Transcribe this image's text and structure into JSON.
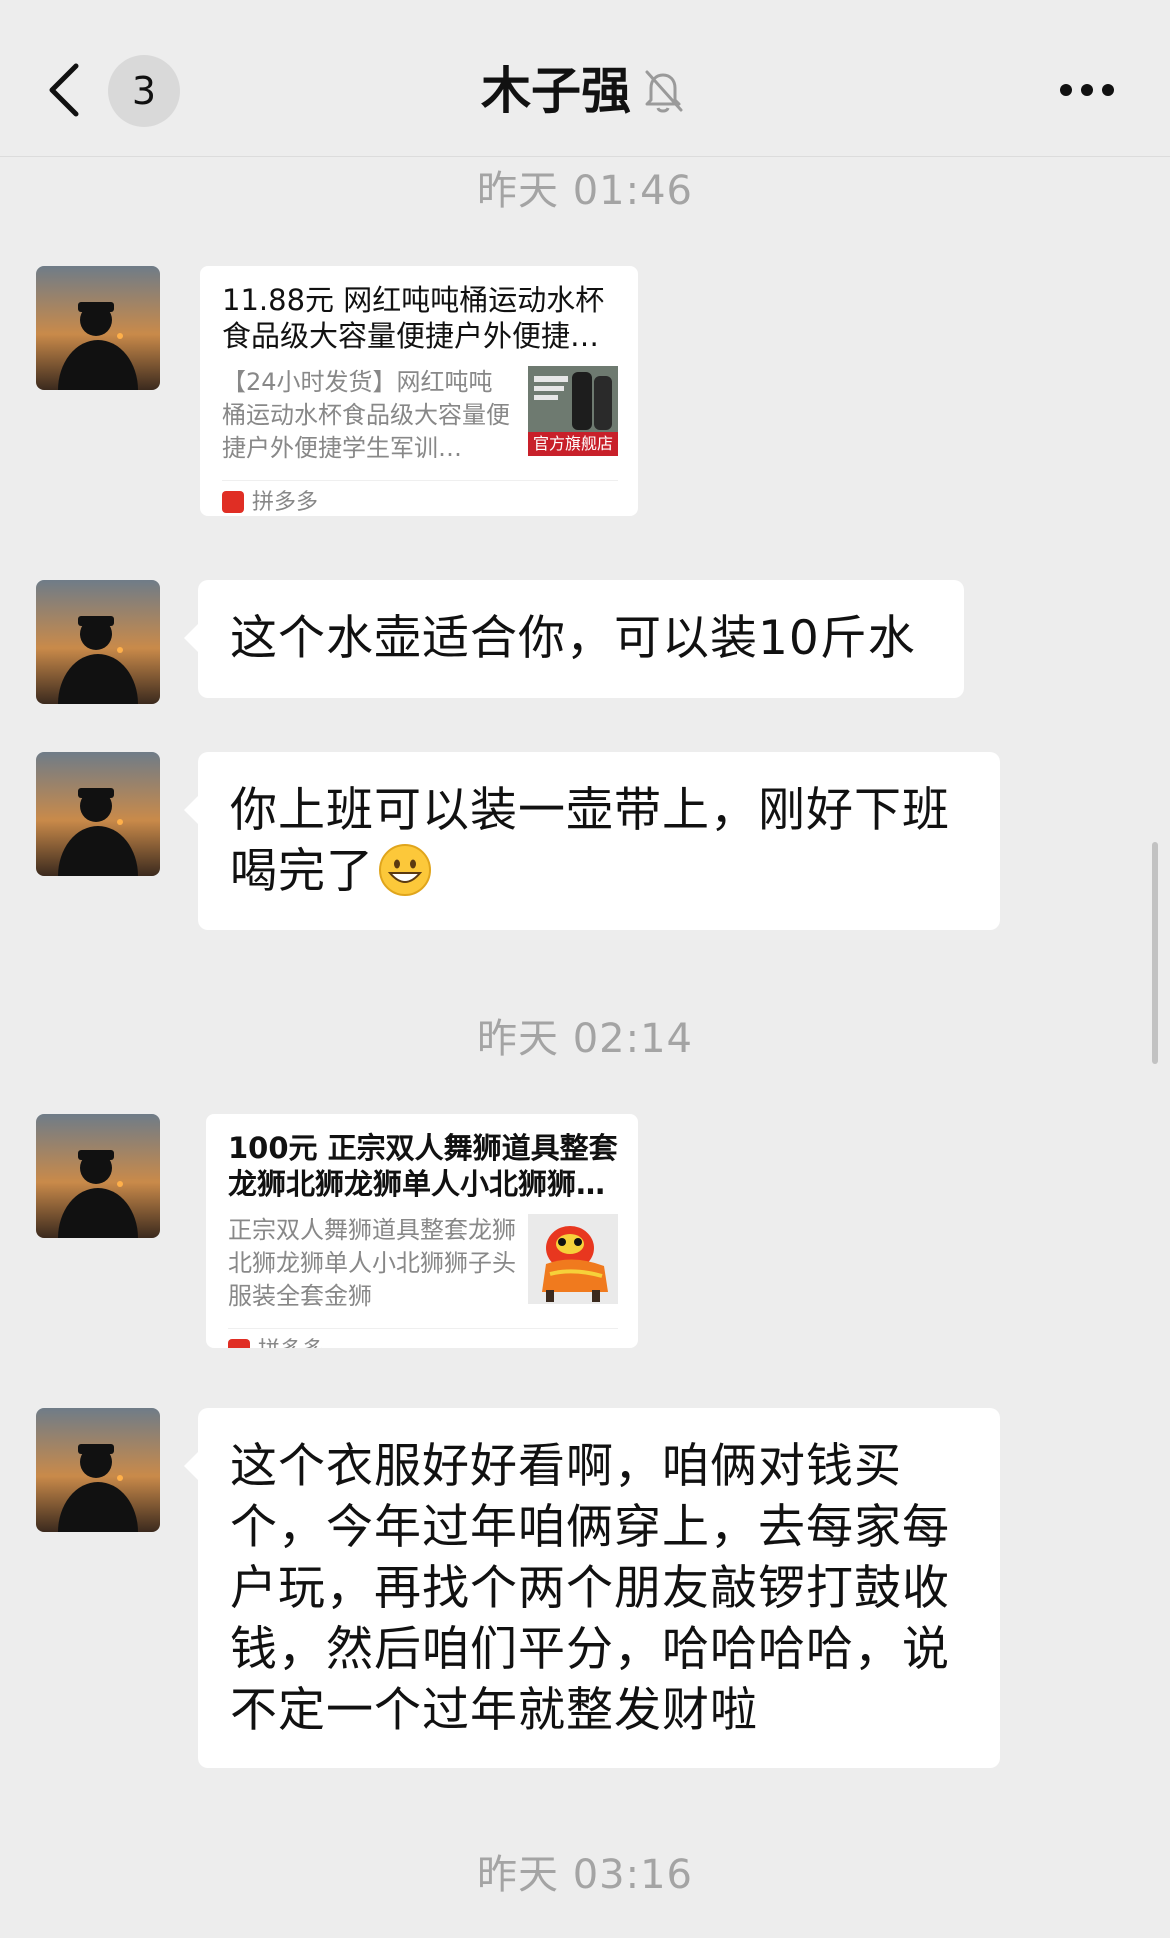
{
  "header": {
    "back_icon": "chevron-left-icon",
    "unread_count": "3",
    "title": "木子强",
    "mute_icon": "bell-muted-icon",
    "more_icon": "more-dots-icon"
  },
  "messages": [
    {
      "type": "time",
      "text": "昨天 01:46"
    },
    {
      "type": "card",
      "title": "11.88元 网红吨吨桶运动水杯食品级大容量便捷户外便捷…",
      "desc": "【24小时发货】网红吨吨桶运动水杯食品级大容量便捷户外便捷学生军训…",
      "thumb_badge": "官方旗舰店",
      "source": "拼多多"
    },
    {
      "type": "text",
      "text": "这个水壶适合你，可以装10斤水"
    },
    {
      "type": "text",
      "text": "你上班可以装一壶带上，刚好下班喝完了",
      "emoji": "grinning-face-emoji"
    },
    {
      "type": "time",
      "text": "昨天 02:14"
    },
    {
      "type": "card",
      "title": "100元 正宗双人舞狮道具整套龙狮北狮龙狮单人小北狮狮…",
      "desc": "正宗双人舞狮道具整套龙狮北狮龙狮单人小北狮狮子头服装全套金狮",
      "source": "拼多多"
    },
    {
      "type": "text",
      "text": "这个衣服好好看啊，咱俩对钱买个，今年过年咱俩穿上，去每家每户玩，再找个两个朋友敲锣打鼓收钱，然后咱们平分，哈哈哈哈，说不定一个过年就整发财啦"
    },
    {
      "type": "time",
      "text": "昨天 03:16"
    }
  ],
  "colors": {
    "background": "#ededed",
    "bubble": "#ffffff",
    "timestamp": "#a4a4a4",
    "pdd_brand": "#e02e24"
  }
}
